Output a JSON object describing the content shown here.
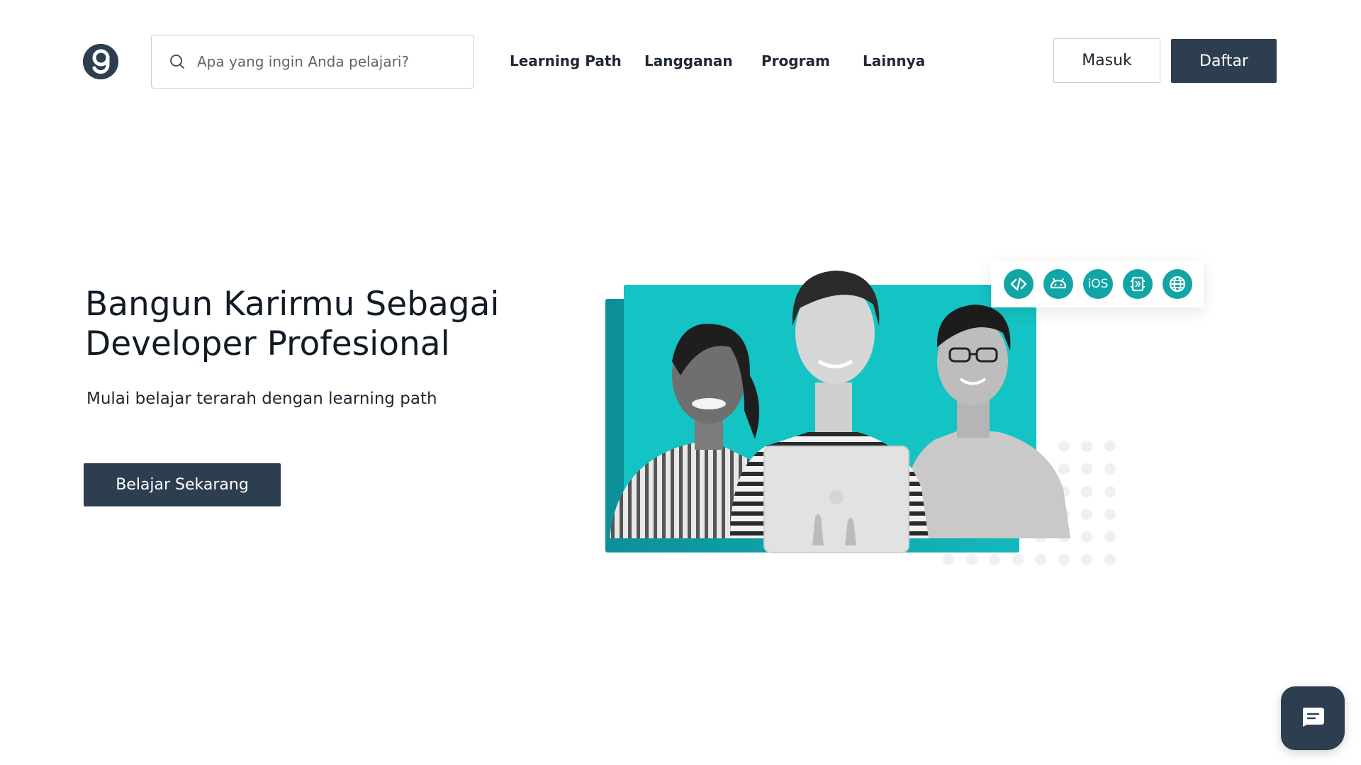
{
  "header": {
    "logo_icon": "dicoding-logo-icon",
    "search": {
      "icon": "search-icon",
      "placeholder": "Apa yang ingin Anda pelajari?"
    },
    "nav": [
      {
        "label": "Learning Path"
      },
      {
        "label": "Langganan"
      },
      {
        "label": "Program"
      },
      {
        "label": "Lainnya"
      }
    ],
    "login_label": "Masuk",
    "register_label": "Daftar"
  },
  "hero": {
    "title_line1": "Bangun Karirmu Sebagai",
    "title_line2": "Developer Profesional",
    "subtitle": "Mulai belajar terarah dengan learning path",
    "cta_label": "Belajar Sekarang",
    "tech_icons": [
      {
        "icon": "code-icon"
      },
      {
        "icon": "android-icon"
      },
      {
        "icon": "ios-icon",
        "label": "iOS"
      },
      {
        "icon": "chip-icon"
      },
      {
        "icon": "globe-icon"
      }
    ]
  },
  "chat": {
    "icon": "chat-icon"
  },
  "colors": {
    "primary": "#2d3e50",
    "accent": "#11a5a5",
    "accent_light": "#14c3c3"
  }
}
